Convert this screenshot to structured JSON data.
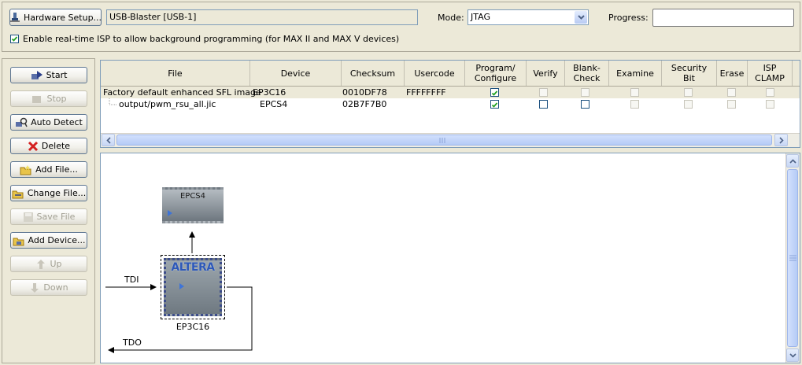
{
  "hardware": {
    "setup_label": "Hardware Setup...",
    "device": "USB-Blaster [USB-1]"
  },
  "mode": {
    "label": "Mode:",
    "value": "JTAG"
  },
  "progress": {
    "label": "Progress:",
    "value": ""
  },
  "isp": {
    "label": "Enable real-time ISP to allow background programming (for MAX II and MAX V devices)",
    "checked": true
  },
  "sidebar": {
    "start": "Start",
    "stop": "Stop",
    "auto_detect": "Auto Detect",
    "delete": "Delete",
    "add_file": "Add File...",
    "change_file": "Change File...",
    "save_file": "Save File",
    "add_device": "Add Device...",
    "up": "Up",
    "down": "Down"
  },
  "table": {
    "columns": [
      "File",
      "Device",
      "Checksum",
      "Usercode",
      "Program/\nConfigure",
      "Verify",
      "Blank-\nCheck",
      "Examine",
      "Security\nBit",
      "Erase",
      "ISP\nCLAMP"
    ],
    "rows": [
      {
        "file": "Factory default enhanced SFL image",
        "device": "EP3C16",
        "checksum": "0010DF78",
        "usercode": "FFFFFFFF",
        "program": true,
        "verify": false,
        "blank_check": false
      },
      {
        "file": "output/pwm_rsu_all.jic",
        "device": "EPCS4",
        "checksum": "02B7F7B0",
        "usercode": "",
        "program": true,
        "verify": false,
        "blank_check": false
      }
    ]
  },
  "diagram": {
    "flash_chip": "EPCS4",
    "fpga_chip": "EP3C16",
    "fpga_logo": "ALTERA",
    "tdi": "TDI",
    "tdo": "TDO"
  },
  "colors": {
    "selected_row": "#ece9d8",
    "scroll_thumb": "#c1d3fb",
    "chip_top": "#9aa3aa"
  }
}
